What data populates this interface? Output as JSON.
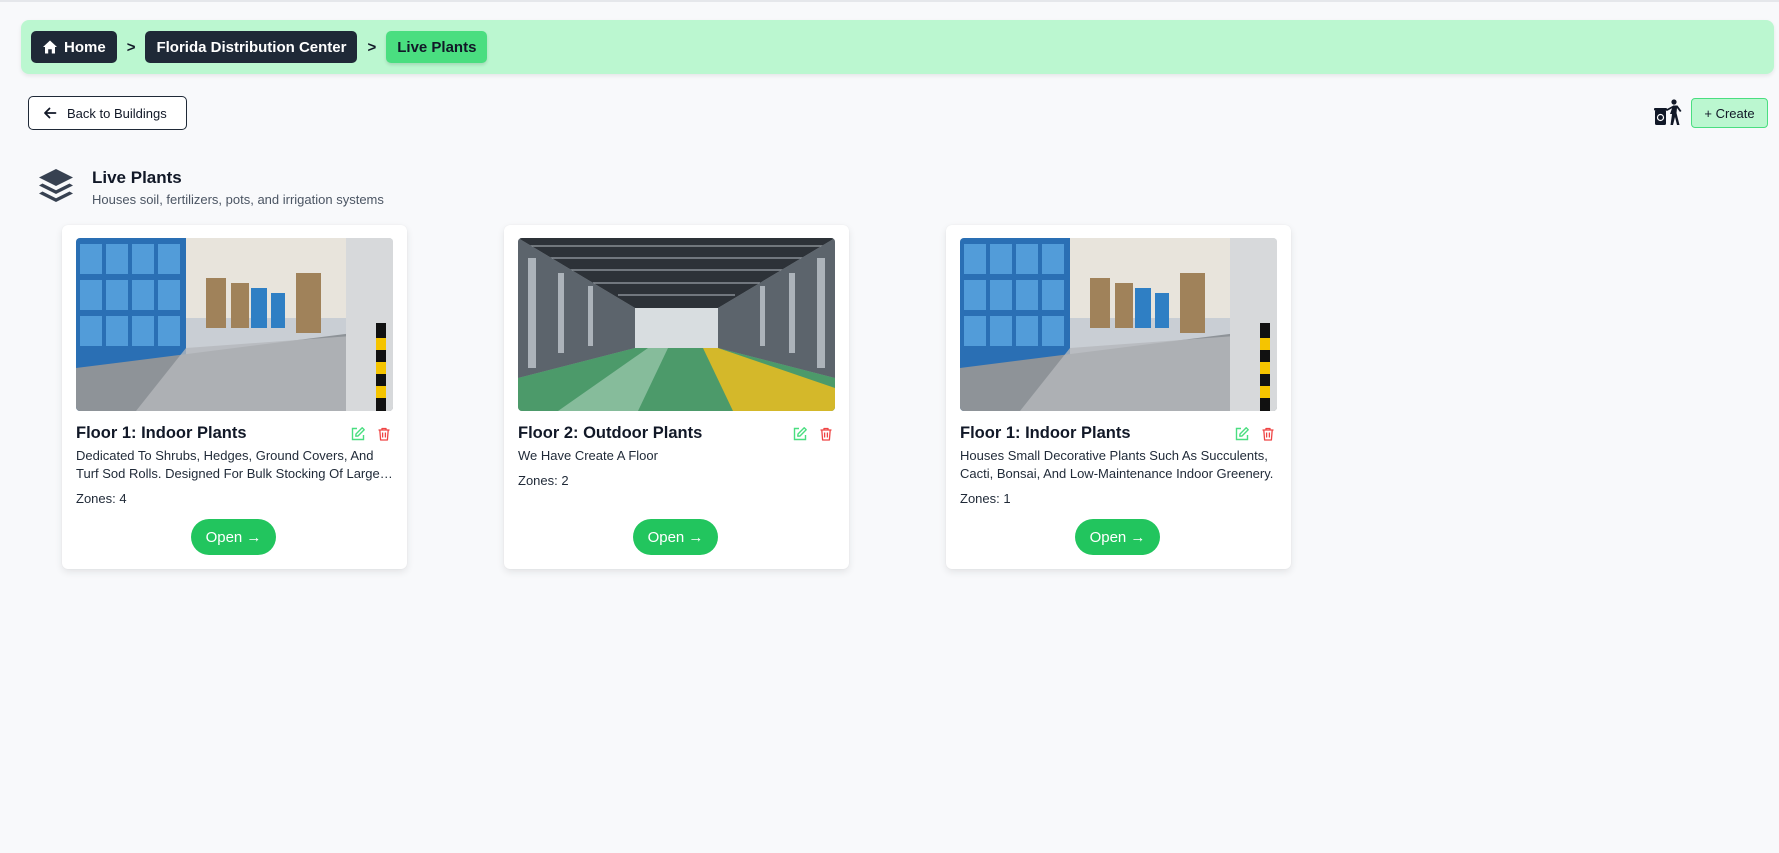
{
  "breadcrumb": {
    "home": "Home",
    "building": "Florida Distribution Center",
    "current": "Live Plants",
    "separator": ">"
  },
  "toolbar": {
    "back_label": "Back to Buildings",
    "create_label": "+ Create"
  },
  "section": {
    "title": "Live Plants",
    "subtitle": "Houses soil, fertilizers, pots, and irrigation systems"
  },
  "cards": [
    {
      "title": "Floor 1: Indoor Plants",
      "description": "Dedicated To Shrubs, Hedges, Ground Covers, And Turf Sod Rolls. Designed For Bulk Stocking Of Large Plants And Landscape Materials.",
      "zones": "Zones: 4",
      "open_label": "Open →"
    },
    {
      "title": "Floor 2: Outdoor Plants",
      "description": "We Have Create A Floor",
      "zones": "Zones: 2",
      "open_label": "Open →"
    },
    {
      "title": "Floor 1: Indoor Plants",
      "description": "Houses Small Decorative Plants Such As Succulents, Cacti, Bonsai, And Low-Maintenance Indoor Greenery.",
      "zones": "Zones: 1",
      "open_label": "Open →"
    }
  ],
  "colors": {
    "crumb_bar": "#bbf7d0",
    "crumb_dark": "#1f2937",
    "crumb_active": "#4ade80",
    "open_button": "#22c55e",
    "edit_icon": "#4ade80",
    "delete_icon": "#ef4444"
  },
  "icons": {
    "home": "home-icon",
    "back": "arrow-left-icon",
    "recycle": "recycle-bin-icon",
    "section": "layers-icon",
    "edit": "edit-icon",
    "delete": "trash-icon"
  }
}
